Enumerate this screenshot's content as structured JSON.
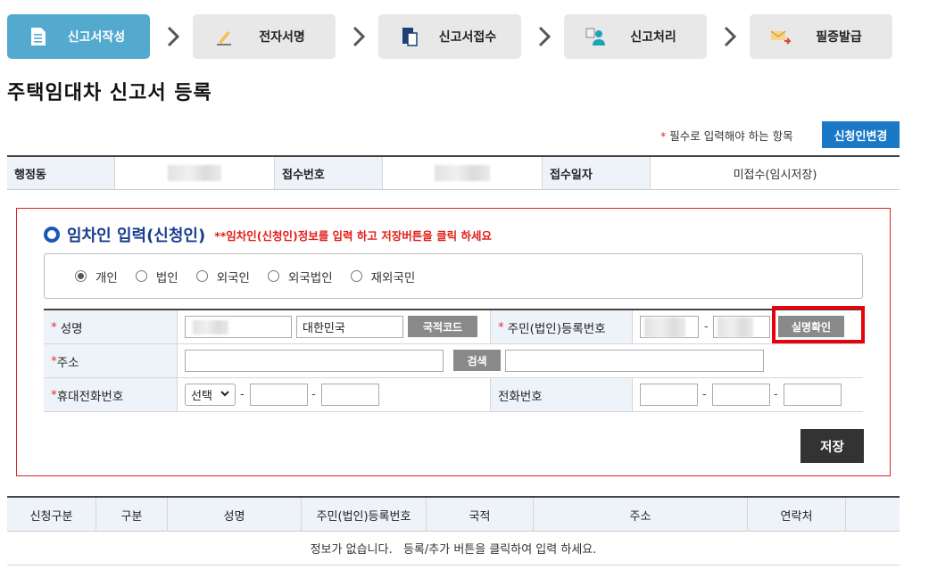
{
  "steps": [
    {
      "label": "신고서작성",
      "icon": "document-icon",
      "active": true
    },
    {
      "label": "전자서명",
      "icon": "pen-icon",
      "active": false
    },
    {
      "label": "신고서접수",
      "icon": "file-receive-icon",
      "active": false
    },
    {
      "label": "신고처리",
      "icon": "person-process-icon",
      "active": false
    },
    {
      "label": "필증발급",
      "icon": "certificate-icon",
      "active": false
    }
  ],
  "page_title": "주택임대차 신고서 등록",
  "required_note": {
    "star": "*",
    "text": "필수로 입력해야 하는 항목"
  },
  "change_applicant_button": "신청인변경",
  "info": {
    "admin_dong_label": "행정동",
    "receipt_no_label": "접수번호",
    "receipt_date_label": "접수일자",
    "receipt_date_value": "미접수(임시저장)"
  },
  "applicant": {
    "title": "임차인 입력(신청인)",
    "hint": "**임차인(신청인)정보를 입력 하고 저장버튼을 클릭 하세요",
    "types": [
      {
        "label": "개인",
        "checked": true
      },
      {
        "label": "법인",
        "checked": false
      },
      {
        "label": "외국인",
        "checked": false
      },
      {
        "label": "외국법인",
        "checked": false
      },
      {
        "label": "재외국민",
        "checked": false
      }
    ],
    "name_label": "성명",
    "nationality_value": "대한민국",
    "country_code_button": "국적코드",
    "resident_no_label": "주민(법인)등록번호",
    "verify_button": "실명확인",
    "address_label": "주소",
    "search_button": "검색",
    "mobile_label": "휴대전화번호",
    "mobile_select": "선택",
    "phone_label": "전화번호",
    "star": "*",
    "save_button": "저장"
  },
  "list": {
    "headers": [
      "신청구분",
      "구분",
      "성명",
      "주민(법인)등록번호",
      "국적",
      "주소",
      "연락처"
    ],
    "empty_message": "정보가 없습니다.   등록/추가 버튼을 클릭하여 입력 하세요."
  },
  "colors": {
    "accent": "#54a9cf",
    "blue_button": "#1a79c7",
    "highlight": "#e8000b"
  }
}
